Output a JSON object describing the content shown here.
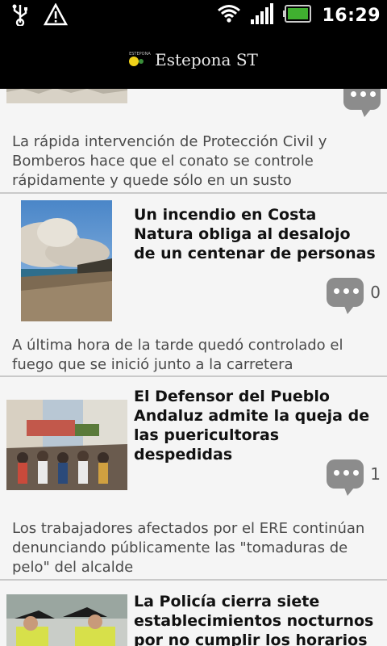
{
  "status_bar": {
    "time": "16:29",
    "icons": [
      "usb-icon",
      "warning-icon",
      "wifi-icon",
      "signal-icon",
      "battery-icon"
    ]
  },
  "app": {
    "name": "Estepona ST",
    "logo_small": "ESTEPONA"
  },
  "articles": [
    {
      "headline": "",
      "summary": "La rápida intervención de Protección Civil y Bomberos hace que el conato se controle rápidamente y quede sólo en un susto",
      "comments": ""
    },
    {
      "headline": "Un incendio en Costa Natura obliga al desalojo de un centenar de personas",
      "summary": "A última hora de la tarde quedó controlado el fuego que se inició junto a la carretera",
      "comments": "0"
    },
    {
      "headline": "El Defensor del Pueblo Andaluz admite la queja de las puericultoras despedidas",
      "summary": "Los trabajadores afectados por el ERE continúan denunciando públicamente las \"tomaduras de pelo\" del alcalde",
      "comments": "1"
    },
    {
      "headline": "La Policía cierra siete establecimientos nocturnos por no cumplir los horarios",
      "summary": "",
      "comments": ""
    }
  ],
  "colors": {
    "background": "#f4f4f4",
    "bar": "#000000",
    "bubble": "#8c8c8c"
  }
}
